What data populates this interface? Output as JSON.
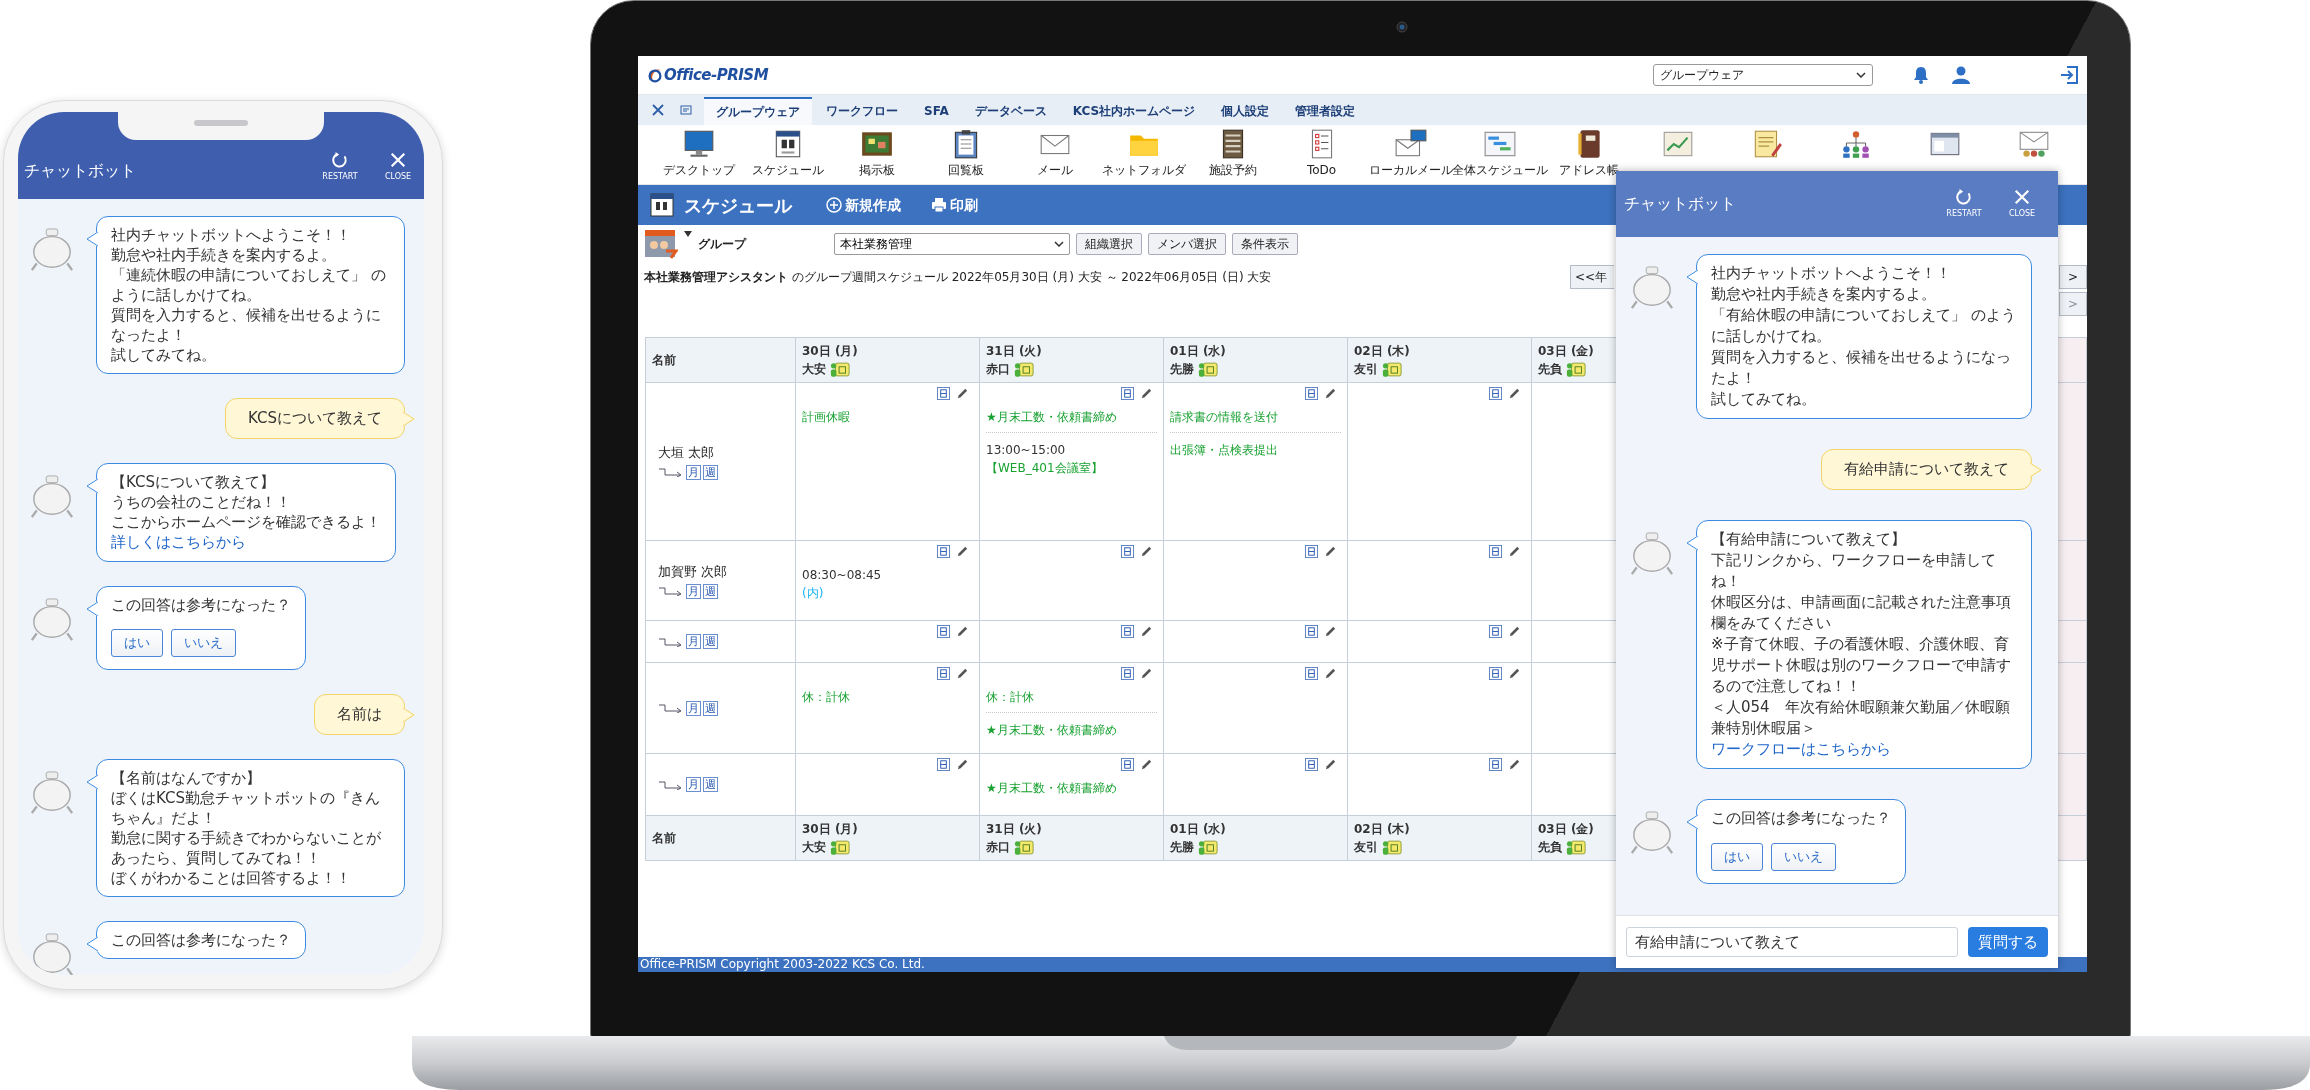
{
  "phone": {
    "chatbot": {
      "title": "チャットボット",
      "restart": "RESTART",
      "close": "CLOSE",
      "messages": [
        {
          "kind": "bot",
          "lines": [
            "社内チャットボットへようこそ！！",
            "勤怠や社内手続きを案内するよ。",
            "「連続休暇の申請についておしえて」 のように話しかけてね。",
            "質問を入力すると、候補を出せるようになったよ！",
            "試してみてね。"
          ]
        },
        {
          "kind": "user",
          "text": "KCSについて教えて"
        },
        {
          "kind": "bot",
          "lines": [
            "【KCSについて教えて】",
            "うちの会社のことだね！！",
            "ここからホームページを確認できるよ！"
          ],
          "link": "詳しくはこちらから"
        },
        {
          "kind": "bot",
          "lines": [
            "この回答は参考になった？"
          ],
          "buttons": [
            "はい",
            "いいえ"
          ]
        },
        {
          "kind": "user",
          "text": "名前は"
        },
        {
          "kind": "bot",
          "lines": [
            "【名前はなんですか】",
            "ぼくはKCS勤怠チャットボットの『きんちゃん』だよ！",
            "勤怠に関する手続きでわからないことがあったら、質問してみてね！！",
            "ぼくがわかることは回答するよ！！"
          ]
        },
        {
          "kind": "bot",
          "lines": [
            "この回答は参考になった？"
          ]
        }
      ]
    }
  },
  "laptop": {
    "header": {
      "logo": "Office-PRISM",
      "app_select": "グループウェア"
    },
    "tabs": [
      {
        "label": "グループウェア",
        "selected": true
      },
      {
        "label": "ワークフロー",
        "selected": false
      },
      {
        "label": "SFA",
        "selected": false
      },
      {
        "label": "データベース",
        "selected": false
      },
      {
        "label": "KCS社内ホームページ",
        "selected": false
      },
      {
        "label": "個人設定",
        "selected": false
      },
      {
        "label": "管理者設定",
        "selected": false
      }
    ],
    "toolbar": [
      "デスクトップ",
      "スケジュール",
      "掲示板",
      "回覧板",
      "メール",
      "ネットフォルダ",
      "施設予約",
      "ToDo",
      "ローカルメール",
      "全体スケジュール",
      "アドレス帳"
    ],
    "page_title": "スケジュール",
    "actions": [
      "新規作成",
      "印刷"
    ],
    "group_label": "グループ",
    "group_select": "本社業務管理",
    "group_buttons": [
      "組織選択",
      "メンバ選択",
      "条件表示"
    ],
    "summary": "**本社業務管理アシスタント** のグループ週間スケジュール 2022年05月30日 (月) 大安 ～ 2022年06月05日 (日) 大安",
    "nav_left": {
      "label": "<<年",
      "disabled": false
    },
    "nav_right": {
      "label": ">",
      "disabled": false
    },
    "nav_right_lower": {
      "label": ">",
      "disabled": true
    },
    "table": {
      "name_header": "名前",
      "days": [
        {
          "date": "30日 (月)",
          "rokuyo": "大安"
        },
        {
          "date": "31日 (火)",
          "rokuyo": "赤口"
        },
        {
          "date": "01日 (水)",
          "rokuyo": "先勝"
        },
        {
          "date": "02日 (木)",
          "rokuyo": "友引"
        },
        {
          "date": "03日 (金)",
          "rokuyo": "先負"
        }
      ],
      "rows": [
        {
          "name": "大垣 太郎",
          "links": [
            "月",
            "週"
          ],
          "cells": [
            [
              {
                "kind": "event",
                "text": "計画休暇"
              }
            ],
            [
              {
                "kind": "event",
                "text": "★月末工数・依頼書締め"
              },
              {
                "kind": "timed",
                "time": "13:00~15:00",
                "text": "【WEB_401会議室】",
                "color": "#17a130"
              }
            ],
            [
              {
                "kind": "event",
                "text": "請求書の情報を送付"
              },
              {
                "kind": "event",
                "text": "出張簿・点検表提出"
              }
            ],
            [],
            []
          ]
        },
        {
          "name": "加賀野 次郎",
          "links": [
            "月",
            "週"
          ],
          "cells": [
            [
              {
                "kind": "timed",
                "time": "08:30~08:45",
                "text": "(内)",
                "color": "#1ab4f0"
              }
            ],
            [],
            [],
            [],
            []
          ]
        },
        {
          "links": [
            "月",
            "週"
          ],
          "cells": [
            [],
            [],
            [],
            [],
            []
          ]
        },
        {
          "links": [
            "月",
            "週"
          ],
          "cells": [
            [
              {
                "kind": "event",
                "text": "休：計休"
              }
            ],
            [
              {
                "kind": "event",
                "text": "休：計休"
              },
              {
                "kind": "event",
                "text": "★月末工数・依頼書締め"
              }
            ],
            [],
            [],
            []
          ]
        },
        {
          "links": [
            "月",
            "週"
          ],
          "cells": [
            [],
            [
              {
                "kind": "event",
                "text": "★月末工数・依頼書締め"
              }
            ],
            [],
            [],
            []
          ]
        }
      ],
      "footer_name_header": "名前",
      "footer_days": [
        {
          "date": "30日 (月)",
          "rokuyo": "大安"
        },
        {
          "date": "31日 (火)",
          "rokuyo": "赤口"
        },
        {
          "date": "01日 (水)",
          "rokuyo": "先勝"
        },
        {
          "date": "02日 (木)",
          "rokuyo": "友引"
        },
        {
          "date": "03日 (金)",
          "rokuyo": "先負"
        }
      ]
    },
    "footer": "Office-PRISM Copyright 2003-2022 KCS Co. Ltd.",
    "chatbot": {
      "title": "チャットボット",
      "restart": "RESTART",
      "close": "CLOSE",
      "messages": [
        {
          "kind": "bot",
          "lines": [
            "社内チャットボットへようこそ！！",
            "勤怠や社内手続きを案内するよ。",
            "「有給休暇の申請についておしえて」 のように話しかけてね。",
            "質問を入力すると、候補を出せるようになったよ！",
            "試してみてね。"
          ]
        },
        {
          "kind": "user",
          "text": "有給申請について教えて"
        },
        {
          "kind": "bot",
          "lines": [
            "【有給申請について教えて】",
            "下記リンクから、ワークフローを申請してね！",
            "休暇区分は、申請画面に記載された注意事項欄をみてください",
            "※子育て休暇、子の看護休暇、介護休暇、育児サポート休暇は別のワークフローで申請するので注意してね！！",
            "＜人054　年次有給休暇願兼欠勤届／休暇願兼特別休暇届＞"
          ],
          "link": "ワークフローはこちらから"
        },
        {
          "kind": "bot",
          "lines": [
            "この回答は参考になった？"
          ],
          "buttons": [
            "はい",
            "いいえ"
          ]
        }
      ],
      "input": {
        "value": "有給申請について教えて"
      },
      "send": "質問する"
    }
  }
}
